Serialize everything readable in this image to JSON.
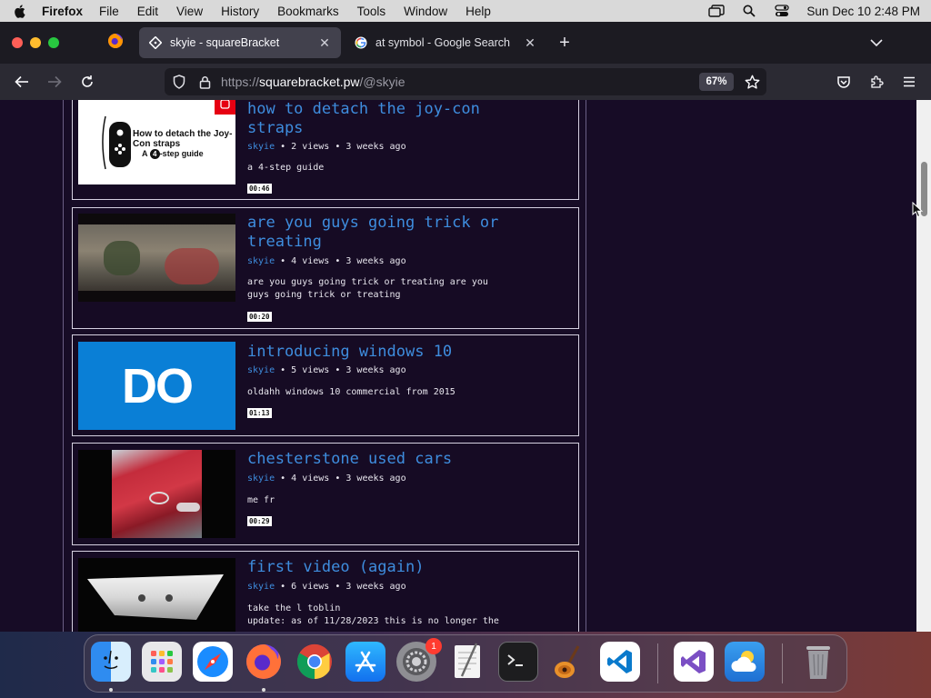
{
  "menubar": {
    "app_name": "Firefox",
    "menus": [
      "File",
      "Edit",
      "View",
      "History",
      "Bookmarks",
      "Tools",
      "Window",
      "Help"
    ],
    "clock": "Sun Dec 10  2:48 PM"
  },
  "tabs": {
    "active_title": "skyie - squareBracket",
    "inactive_title": "at symbol - Google Search"
  },
  "navbar": {
    "url_scheme": "https://",
    "url_host": "squarebracket.pw",
    "url_path": "/@skyie",
    "zoom": "67%"
  },
  "videos": [
    {
      "title": "how to detach the joy-con straps",
      "author": "skyie",
      "stats": " • 2 views • 3 weeks ago",
      "description": "a 4-step guide",
      "duration": "00:46",
      "thumb_title": "How to detach the Joy-Con straps",
      "thumb_sub_a": "A",
      "thumb_sub_num": "4",
      "thumb_sub_b": "-step guide"
    },
    {
      "title": "are you guys going trick or treating",
      "author": "skyie",
      "stats": " • 4 views • 3 weeks ago",
      "description": "are you guys going trick or treating are you guys going trick or treating",
      "duration": "00:20"
    },
    {
      "title": "introducing windows 10",
      "author": "skyie",
      "stats": " • 5 views • 3 weeks ago",
      "description": "oldahh windows 10 commercial from 2015",
      "duration": "01:13",
      "thumb_text": "DO"
    },
    {
      "title": "chesterstone used cars",
      "author": "skyie",
      "stats": " • 4 views • 3 weeks ago",
      "description": "me fr",
      "duration": "00:29"
    },
    {
      "title": "first video (again)",
      "author": "skyie",
      "stats": " • 6 views • 3 weeks ago",
      "description_line1": "take the l toblin",
      "description_line2": "update: as of 11/28/2023 this is no longer the"
    }
  ],
  "dock": {
    "settings_badge": "1",
    "apps": [
      "finder",
      "launchpad",
      "safari",
      "firefox",
      "chrome",
      "app-store",
      "system-settings",
      "textedit",
      "terminal",
      "garageband",
      "vscode",
      "visual-studio",
      "weather",
      "trash"
    ]
  },
  "colors": {
    "page_bg": "#170c26",
    "link_blue": "#3e8dde",
    "tab_active": "#42414d",
    "chrome_dark": "#1c1b22"
  }
}
